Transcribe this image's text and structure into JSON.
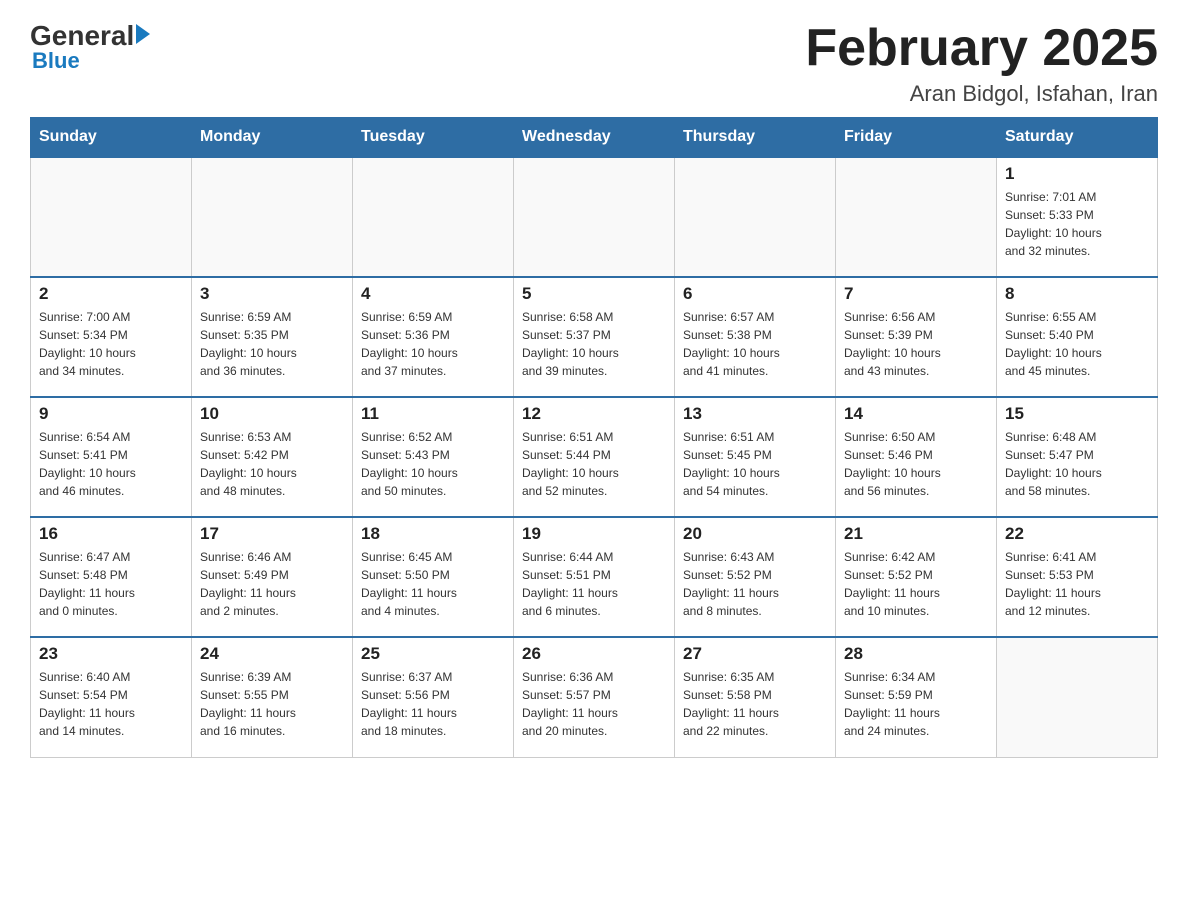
{
  "logo": {
    "general": "General",
    "blue": "Blue"
  },
  "header": {
    "title": "February 2025",
    "location": "Aran Bidgol, Isfahan, Iran"
  },
  "days_of_week": [
    "Sunday",
    "Monday",
    "Tuesday",
    "Wednesday",
    "Thursday",
    "Friday",
    "Saturday"
  ],
  "weeks": [
    [
      {
        "day": "",
        "info": ""
      },
      {
        "day": "",
        "info": ""
      },
      {
        "day": "",
        "info": ""
      },
      {
        "day": "",
        "info": ""
      },
      {
        "day": "",
        "info": ""
      },
      {
        "day": "",
        "info": ""
      },
      {
        "day": "1",
        "info": "Sunrise: 7:01 AM\nSunset: 5:33 PM\nDaylight: 10 hours\nand 32 minutes."
      }
    ],
    [
      {
        "day": "2",
        "info": "Sunrise: 7:00 AM\nSunset: 5:34 PM\nDaylight: 10 hours\nand 34 minutes."
      },
      {
        "day": "3",
        "info": "Sunrise: 6:59 AM\nSunset: 5:35 PM\nDaylight: 10 hours\nand 36 minutes."
      },
      {
        "day": "4",
        "info": "Sunrise: 6:59 AM\nSunset: 5:36 PM\nDaylight: 10 hours\nand 37 minutes."
      },
      {
        "day": "5",
        "info": "Sunrise: 6:58 AM\nSunset: 5:37 PM\nDaylight: 10 hours\nand 39 minutes."
      },
      {
        "day": "6",
        "info": "Sunrise: 6:57 AM\nSunset: 5:38 PM\nDaylight: 10 hours\nand 41 minutes."
      },
      {
        "day": "7",
        "info": "Sunrise: 6:56 AM\nSunset: 5:39 PM\nDaylight: 10 hours\nand 43 minutes."
      },
      {
        "day": "8",
        "info": "Sunrise: 6:55 AM\nSunset: 5:40 PM\nDaylight: 10 hours\nand 45 minutes."
      }
    ],
    [
      {
        "day": "9",
        "info": "Sunrise: 6:54 AM\nSunset: 5:41 PM\nDaylight: 10 hours\nand 46 minutes."
      },
      {
        "day": "10",
        "info": "Sunrise: 6:53 AM\nSunset: 5:42 PM\nDaylight: 10 hours\nand 48 minutes."
      },
      {
        "day": "11",
        "info": "Sunrise: 6:52 AM\nSunset: 5:43 PM\nDaylight: 10 hours\nand 50 minutes."
      },
      {
        "day": "12",
        "info": "Sunrise: 6:51 AM\nSunset: 5:44 PM\nDaylight: 10 hours\nand 52 minutes."
      },
      {
        "day": "13",
        "info": "Sunrise: 6:51 AM\nSunset: 5:45 PM\nDaylight: 10 hours\nand 54 minutes."
      },
      {
        "day": "14",
        "info": "Sunrise: 6:50 AM\nSunset: 5:46 PM\nDaylight: 10 hours\nand 56 minutes."
      },
      {
        "day": "15",
        "info": "Sunrise: 6:48 AM\nSunset: 5:47 PM\nDaylight: 10 hours\nand 58 minutes."
      }
    ],
    [
      {
        "day": "16",
        "info": "Sunrise: 6:47 AM\nSunset: 5:48 PM\nDaylight: 11 hours\nand 0 minutes."
      },
      {
        "day": "17",
        "info": "Sunrise: 6:46 AM\nSunset: 5:49 PM\nDaylight: 11 hours\nand 2 minutes."
      },
      {
        "day": "18",
        "info": "Sunrise: 6:45 AM\nSunset: 5:50 PM\nDaylight: 11 hours\nand 4 minutes."
      },
      {
        "day": "19",
        "info": "Sunrise: 6:44 AM\nSunset: 5:51 PM\nDaylight: 11 hours\nand 6 minutes."
      },
      {
        "day": "20",
        "info": "Sunrise: 6:43 AM\nSunset: 5:52 PM\nDaylight: 11 hours\nand 8 minutes."
      },
      {
        "day": "21",
        "info": "Sunrise: 6:42 AM\nSunset: 5:52 PM\nDaylight: 11 hours\nand 10 minutes."
      },
      {
        "day": "22",
        "info": "Sunrise: 6:41 AM\nSunset: 5:53 PM\nDaylight: 11 hours\nand 12 minutes."
      }
    ],
    [
      {
        "day": "23",
        "info": "Sunrise: 6:40 AM\nSunset: 5:54 PM\nDaylight: 11 hours\nand 14 minutes."
      },
      {
        "day": "24",
        "info": "Sunrise: 6:39 AM\nSunset: 5:55 PM\nDaylight: 11 hours\nand 16 minutes."
      },
      {
        "day": "25",
        "info": "Sunrise: 6:37 AM\nSunset: 5:56 PM\nDaylight: 11 hours\nand 18 minutes."
      },
      {
        "day": "26",
        "info": "Sunrise: 6:36 AM\nSunset: 5:57 PM\nDaylight: 11 hours\nand 20 minutes."
      },
      {
        "day": "27",
        "info": "Sunrise: 6:35 AM\nSunset: 5:58 PM\nDaylight: 11 hours\nand 22 minutes."
      },
      {
        "day": "28",
        "info": "Sunrise: 6:34 AM\nSunset: 5:59 PM\nDaylight: 11 hours\nand 24 minutes."
      },
      {
        "day": "",
        "info": ""
      }
    ]
  ]
}
